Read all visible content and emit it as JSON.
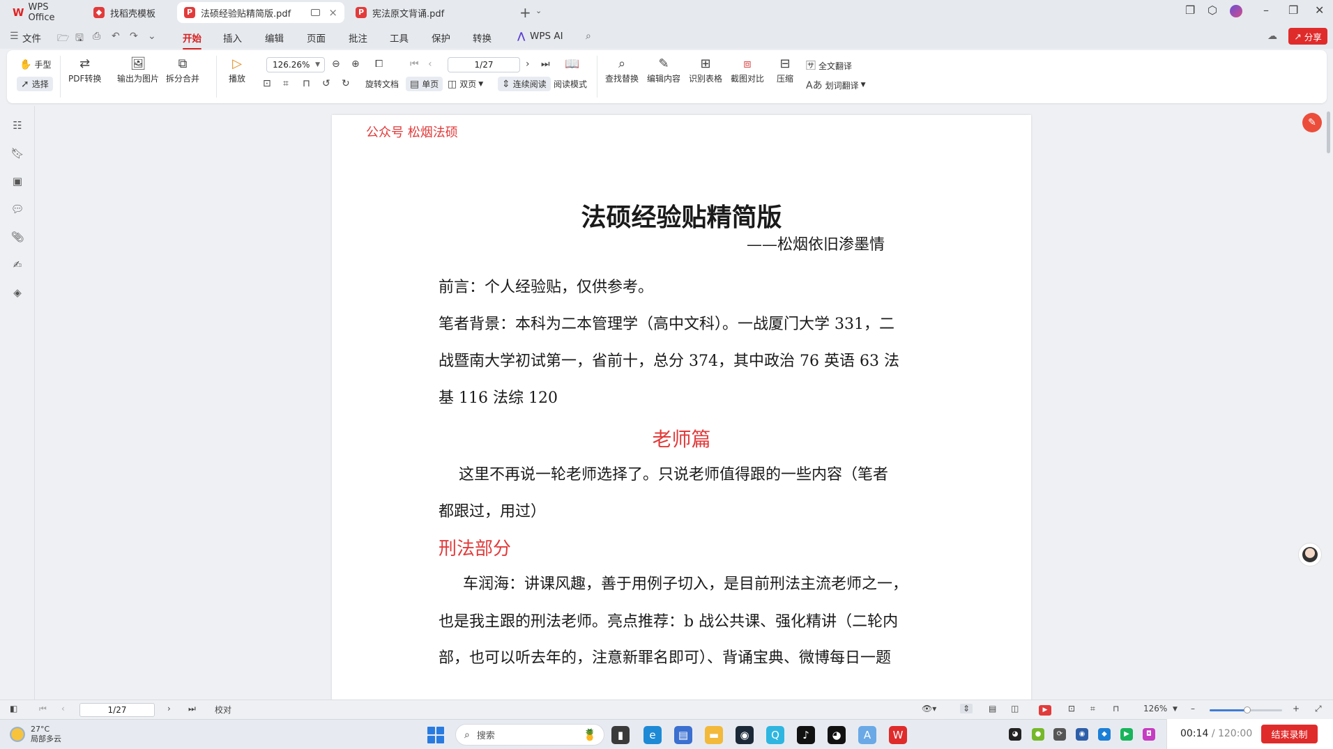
{
  "tabs": [
    {
      "label": "WPS Office"
    },
    {
      "label": "找稻壳模板"
    },
    {
      "label": "法硕经验贴精简版.pdf"
    },
    {
      "label": "宪法原文背诵.pdf"
    }
  ],
  "menu": {
    "file": "文件",
    "items": [
      "开始",
      "插入",
      "编辑",
      "页面",
      "批注",
      "工具",
      "保护",
      "转换"
    ],
    "wps_ai": "WPS AI",
    "share": "分享"
  },
  "ribbon": {
    "hand": "手型",
    "select": "选择",
    "pdf_convert": "PDF转换",
    "export_image": "输出为图片",
    "split_merge": "拆分合并",
    "play": "播放",
    "zoom": "126.26%",
    "page": "1/27",
    "rotate": "旋转文档",
    "single": "单页",
    "double": "双页",
    "continuous": "连续阅读",
    "reading_mode": "阅读模式",
    "find_replace": "查找替换",
    "edit_content": "编辑内容",
    "recognize_table": "识别表格",
    "compare": "截图对比",
    "compress": "压缩",
    "full_translate": "全文翻译",
    "word_translate": "划词翻译"
  },
  "document": {
    "header": "公众号  松烟法硕",
    "title": "法硕经验贴精简版",
    "subtitle": "——松烟依旧渗墨情",
    "lines": [
      "前言：个人经验贴，仅供参考。",
      " 笔者背景：本科为二本管理学（高中文科）。一战厦门大学 331，二",
      "战暨南大学初试第一，省前十，总分 374，其中政治 76  英语 63  法",
      "基 116  法综 120"
    ],
    "section_title": "老师篇",
    "teacher_lines": [
      "这里不再说一轮老师选择了。只说老师值得跟的一些内容（笔者",
      "都跟过，用过）"
    ],
    "heading_criminal": "刑法部分",
    "criminal_lines": [
      "车润海：讲课风趣，善于用例子切入，是目前刑法主流老师之一，",
      "也是我主跟的刑法老师。亮点推荐：b 战公共课、强化精讲（二轮内",
      "部，也可以听去年的，注意新罪名即可）、背诵宝典、微博每日一题"
    ]
  },
  "statusbar": {
    "page": "1/27",
    "proofread": "校对",
    "zoom": "126%",
    "zoom_level": 0.52
  },
  "taskbar": {
    "temperature": "27°C",
    "weather": "局部多云",
    "search_placeholder": "搜索"
  },
  "recording": {
    "elapsed": "00:14",
    "total": "/ 120:00",
    "end_label": "结束录制"
  },
  "colors": {
    "accent": "#d72020",
    "doc_red": "#e23a3a",
    "share": "#e02b2b"
  }
}
